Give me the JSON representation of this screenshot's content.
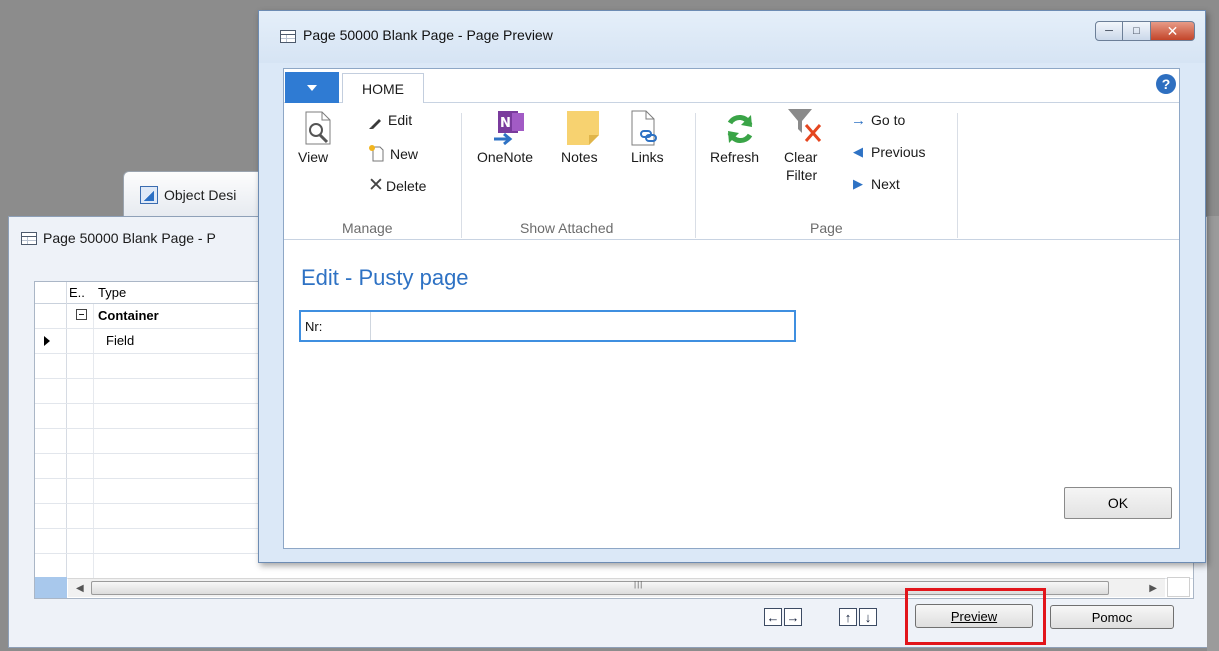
{
  "background": {
    "object_designer_tab": "Object Desi",
    "window_title": "Page 50000 Blank Page - P",
    "grid": {
      "headers": [
        "E..",
        "Type"
      ],
      "rows": [
        {
          "type": "Container",
          "bold": true,
          "collapsible": true
        },
        {
          "type": "Field",
          "bold": false,
          "current": true
        }
      ]
    },
    "buttons": {
      "preview": "Preview",
      "help": "Pomoc"
    }
  },
  "dialog": {
    "title": "Page 50000 Blank Page - Page Preview",
    "ribbon": {
      "tab": "HOME",
      "groups": {
        "manage": {
          "label": "Manage",
          "view": "View",
          "edit": "Edit",
          "new": "New",
          "delete": "Delete"
        },
        "show_attached": {
          "label": "Show Attached",
          "onenote": "OneNote",
          "notes": "Notes",
          "links": "Links"
        },
        "page": {
          "label": "Page",
          "refresh": "Refresh",
          "clear_filter_line1": "Clear",
          "clear_filter_line2": "Filter",
          "go_to": "Go to",
          "previous": "Previous",
          "next": "Next"
        }
      }
    },
    "content_title": "Edit - Pusty page",
    "field": {
      "label": "Nr:",
      "value": ""
    },
    "ok": "OK"
  },
  "colors": {
    "accent_blue": "#2e72c4",
    "highlight_red": "#e2151b"
  }
}
